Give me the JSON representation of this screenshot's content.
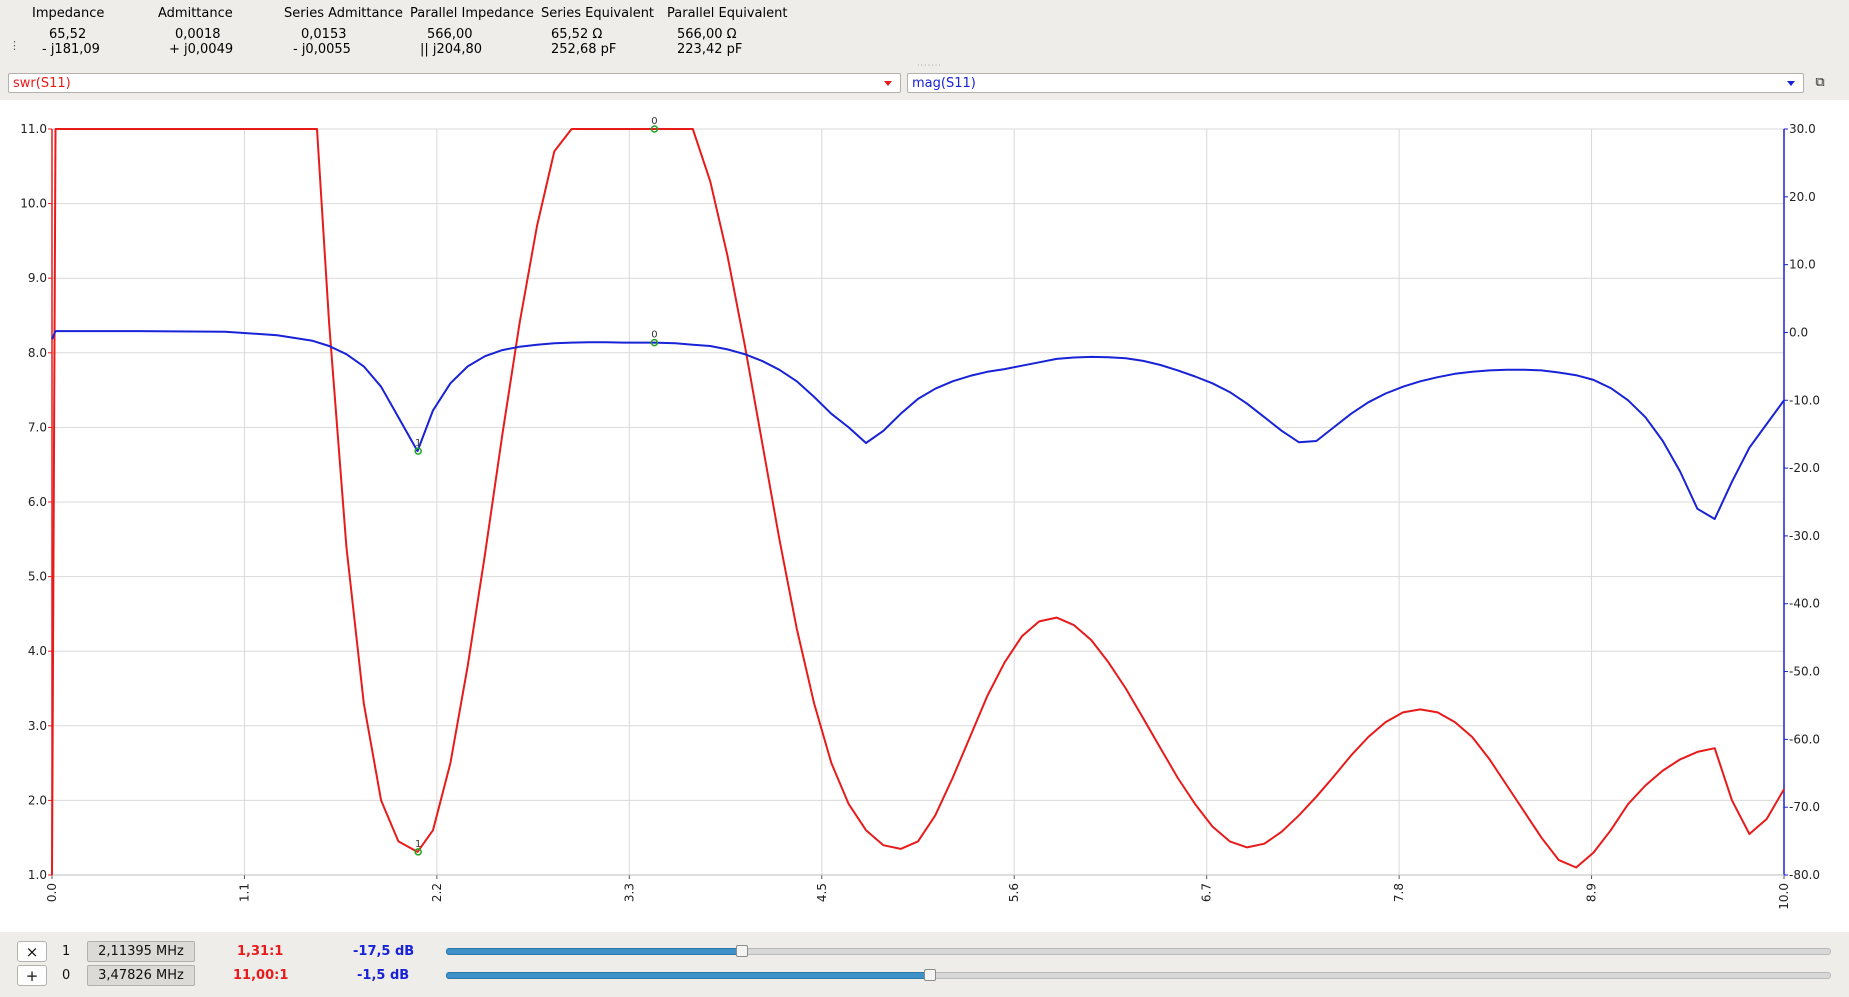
{
  "readout": {
    "columns": [
      {
        "header": "Impedance",
        "line1": "65,52",
        "line2": "- j181,09"
      },
      {
        "header": "Admittance",
        "line1": "0,0018",
        "line2": "+ j0,0049"
      },
      {
        "header": "Series Admittance",
        "line1": "0,0153",
        "line2": "- j0,0055"
      },
      {
        "header": "Parallel Impedance",
        "line1": "566,00",
        "line2": "|| j204,80"
      },
      {
        "header": "Series Equivalent",
        "line1": "65,52 Ω",
        "line2": "252,68 pF"
      },
      {
        "header": "Parallel Equivalent",
        "line1": "566,00 Ω",
        "line2": "223,42 pF"
      }
    ]
  },
  "selectors": {
    "left": {
      "value": "swr(S11)",
      "color": "#e81b1b"
    },
    "right": {
      "value": "mag(S11)",
      "color": "#1822d6"
    }
  },
  "chart_data": {
    "type": "line",
    "xlim": [
      0.0,
      10.0
    ],
    "x_ticks": [
      "0.0",
      "1.1",
      "2.2",
      "3.3",
      "4.5",
      "5.6",
      "6.7",
      "7.8",
      "8.9",
      "10.0"
    ],
    "y_left": {
      "lim": [
        1.0,
        11.0
      ],
      "ticks": [
        "1.0",
        "2.0",
        "3.0",
        "4.0",
        "5.0",
        "6.0",
        "7.0",
        "8.0",
        "9.0",
        "10.0",
        "11.0"
      ]
    },
    "y_right": {
      "lim": [
        -80.0,
        30.0
      ],
      "ticks": [
        "-80.0",
        "-70.0",
        "-60.0",
        "-50.0",
        "-40.0",
        "-30.0",
        "-20.0",
        "-10.0",
        "0.0",
        "10.0",
        "20.0",
        "30.0"
      ]
    },
    "grid": true,
    "series": [
      {
        "axis": "left",
        "color": "#e81b1b",
        "x": [
          0.0,
          0.02,
          0.5,
          1.0,
          1.5,
          1.53,
          1.6,
          1.7,
          1.8,
          1.9,
          2.0,
          2.11,
          2.2,
          2.3,
          2.4,
          2.5,
          2.6,
          2.7,
          2.8,
          2.9,
          3.0,
          3.1,
          3.2,
          3.3,
          3.47,
          3.7,
          3.8,
          3.9,
          4.0,
          4.1,
          4.2,
          4.3,
          4.4,
          4.5,
          4.6,
          4.7,
          4.8,
          4.9,
          5.0,
          5.1,
          5.2,
          5.3,
          5.4,
          5.5,
          5.6,
          5.7,
          5.8,
          5.9,
          6.0,
          6.1,
          6.2,
          6.3,
          6.4,
          6.5,
          6.6,
          6.7,
          6.8,
          6.9,
          7.0,
          7.1,
          7.2,
          7.3,
          7.4,
          7.5,
          7.6,
          7.7,
          7.8,
          7.9,
          8.0,
          8.1,
          8.2,
          8.3,
          8.4,
          8.5,
          8.6,
          8.7,
          8.8,
          8.9,
          9.0,
          9.1,
          9.2,
          9.3,
          9.4,
          9.5,
          9.6,
          9.7,
          9.8,
          9.9,
          10.0
        ],
        "y": [
          1.0,
          11.0,
          11.0,
          11.0,
          11.0,
          11.0,
          8.4,
          5.4,
          3.3,
          2.0,
          1.45,
          1.31,
          1.6,
          2.5,
          3.8,
          5.3,
          6.9,
          8.4,
          9.7,
          10.7,
          11.0,
          11.0,
          11.0,
          11.0,
          11.0,
          11.0,
          10.3,
          9.3,
          8.1,
          6.8,
          5.5,
          4.3,
          3.3,
          2.5,
          1.95,
          1.6,
          1.4,
          1.35,
          1.45,
          1.8,
          2.3,
          2.85,
          3.4,
          3.85,
          4.2,
          4.4,
          4.45,
          4.35,
          4.15,
          3.85,
          3.5,
          3.1,
          2.7,
          2.3,
          1.95,
          1.65,
          1.45,
          1.37,
          1.42,
          1.58,
          1.8,
          2.05,
          2.32,
          2.6,
          2.85,
          3.05,
          3.18,
          3.22,
          3.18,
          3.05,
          2.85,
          2.55,
          2.2,
          1.85,
          1.5,
          1.2,
          1.1,
          1.3,
          1.6,
          1.95,
          2.2,
          2.4,
          2.55,
          2.65,
          2.7,
          2.0,
          1.55,
          1.75,
          2.15
        ]
      },
      {
        "axis": "right",
        "color": "#1822d6",
        "x": [
          0.0,
          0.02,
          0.5,
          1.0,
          1.3,
          1.5,
          1.6,
          1.7,
          1.8,
          1.9,
          2.0,
          2.11,
          2.2,
          2.3,
          2.4,
          2.5,
          2.6,
          2.7,
          2.8,
          2.9,
          3.0,
          3.1,
          3.2,
          3.3,
          3.47,
          3.6,
          3.7,
          3.8,
          3.9,
          4.0,
          4.1,
          4.2,
          4.3,
          4.4,
          4.5,
          4.6,
          4.7,
          4.8,
          4.9,
          5.0,
          5.1,
          5.2,
          5.3,
          5.4,
          5.5,
          5.6,
          5.7,
          5.8,
          5.9,
          6.0,
          6.1,
          6.2,
          6.3,
          6.4,
          6.5,
          6.6,
          6.7,
          6.8,
          6.9,
          7.0,
          7.1,
          7.2,
          7.3,
          7.4,
          7.5,
          7.6,
          7.7,
          7.8,
          7.9,
          8.0,
          8.1,
          8.2,
          8.3,
          8.4,
          8.5,
          8.6,
          8.7,
          8.8,
          8.9,
          9.0,
          9.1,
          9.2,
          9.3,
          9.4,
          9.5,
          9.6,
          9.7,
          9.8,
          9.9,
          10.0
        ],
        "y": [
          -1.0,
          0.2,
          0.2,
          0.1,
          -0.4,
          -1.2,
          -2.0,
          -3.2,
          -5.0,
          -8.0,
          -12.5,
          -17.5,
          -11.5,
          -7.5,
          -5.0,
          -3.5,
          -2.6,
          -2.1,
          -1.8,
          -1.6,
          -1.5,
          -1.45,
          -1.45,
          -1.5,
          -1.5,
          -1.6,
          -1.8,
          -2.0,
          -2.5,
          -3.2,
          -4.2,
          -5.5,
          -7.2,
          -9.5,
          -12.0,
          -14.0,
          -16.3,
          -14.5,
          -12.0,
          -9.8,
          -8.3,
          -7.2,
          -6.4,
          -5.8,
          -5.4,
          -4.9,
          -4.4,
          -3.9,
          -3.7,
          -3.6,
          -3.65,
          -3.8,
          -4.2,
          -4.8,
          -5.6,
          -6.5,
          -7.5,
          -8.8,
          -10.5,
          -12.5,
          -14.5,
          -16.2,
          -16.0,
          -14.0,
          -12.0,
          -10.3,
          -9.0,
          -8.0,
          -7.2,
          -6.6,
          -6.1,
          -5.8,
          -5.6,
          -5.5,
          -5.5,
          -5.6,
          -5.9,
          -6.3,
          -7.0,
          -8.2,
          -10.0,
          -12.5,
          -16.0,
          -20.5,
          -26.0,
          -27.5,
          -22.0,
          -17.0,
          -13.5,
          -10.0
        ]
      }
    ],
    "markers": [
      {
        "label": "1",
        "x": 2.11395,
        "swr": 1.31,
        "mag": -17.5
      },
      {
        "label": "0",
        "x": 3.47826,
        "swr": 11.0,
        "mag": -1.5
      }
    ]
  },
  "markers_panel": {
    "rows": [
      {
        "button": "×",
        "index": "1",
        "freq": "2,11395 MHz",
        "swr": "1,31:1",
        "mag": "-17,5 dB",
        "position": 0.2143
      },
      {
        "button": "+",
        "index": "0",
        "freq": "3,47826 MHz",
        "swr": "11,00:1",
        "mag": "-1,5 dB",
        "position": 0.3499
      }
    ]
  }
}
